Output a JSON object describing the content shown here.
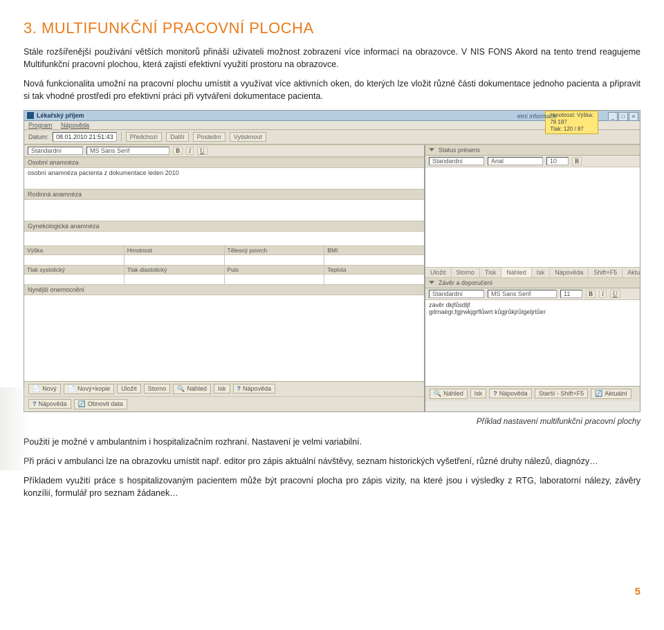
{
  "heading_prefix": "3.",
  "heading": "MULTIFUNKČNÍ PRACOVNÍ PLOCHA",
  "para1": "Stále rozšířenější používání větších monitorů přináší uživateli možnost zobrazení více informací na obrazovce. V NIS FONS Akord na tento trend reagujeme Multifunkční pracovní plochou, která zajistí efektivní využití prostoru na obrazovce.",
  "para2": "Nová funkcionalita umožní na pracovní plochu umístit a využívat více aktivních oken, do kterých lze vložit různé části dokumentace jednoho pacienta a připravit si tak vhodné prostředí pro efektivní práci při vytváření dokumentace pacienta.",
  "caption": "Příklad nastavení multifunkční pracovní plochy",
  "para3": "Použití je možné v ambulantním i hospitalizačním rozhraní. Nastavení je velmi variabilní.",
  "para4": "Při práci v ambulanci lze na obrazovku umístit např. editor pro zápis aktuální návštěvy, seznam historických vyšetření, různé druhy nálezů, diagnózy…",
  "para5": "Příkladem využití práce s hospitalizovaným pacientem může být pracovní plocha pro zápis vizity, na které jsou i výsledky z RTG, laboratorní nálezy, závěry konzílií, formulář pro seznam žádanek…",
  "page_number": "5",
  "app": {
    "title": "Lékařský příjem",
    "menu": {
      "program": "Program",
      "help": "Nápověda"
    },
    "note": {
      "l1": "Hmotnost: Výška:",
      "l2": "78       187",
      "l3": "Tlak: 120 / 87"
    },
    "winbtns": {
      "min": "_",
      "max": "□",
      "close": "×"
    },
    "toolbar": {
      "datum_lbl": "Datum:",
      "datum": "08.01.2010 21:51:43",
      "predchozi": "Předchozí",
      "dalsi": "Další",
      "posledni": "Poslední",
      "vytisknout": "Vytisknout"
    },
    "left": {
      "fmt_std": "Standardní",
      "fmt_font": "MS Sans Serif",
      "fmt_b": "B",
      "fmt_i": "I",
      "fmt_u": "U",
      "sec_osobni": "Osobní anamnéza",
      "osobni_text": "osobní anamnéza pacienta z dokumentace leden 2010",
      "sec_rodinna": "Rodinná anamnéza",
      "sec_gyn": "Gynekologická anamnéza",
      "f_vyska": "Výška",
      "f_hmotnost": "Hmotnost",
      "f_povrch": "Tělesný povrch",
      "f_bmi": "BMI",
      "f_sys": "Tlak systolický",
      "f_dia": "Tlak diastolický",
      "f_puls": "Puls",
      "f_teplota": "Teplota",
      "sec_nyn": "Nynější onemocnění",
      "foot": {
        "novy": "Nový",
        "novy_kopie": "Nový+kopie",
        "ulozit": "Uložit",
        "storno": "Storno",
        "nahled": "Náhled",
        "isk": "Isk",
        "napoveda": "Nápověda",
        "obnovit": "Obnovit data"
      }
    },
    "right": {
      "panel1": "Status présens",
      "fmt_std": "Standardní",
      "fmt_font": "Arial",
      "fmt_size": "10",
      "tabs": {
        "ulozit": "Uložit",
        "storno": "Storno",
        "tisk": "Tisk",
        "nahled": "Náhled",
        "isk": "Isk",
        "napoveda": "Nápověda",
        "shift": "Shift+F5",
        "aktualni": "Aktuální"
      },
      "panel2": "Závěr a doporučení",
      "fmt_font2": "MS Sans Serif",
      "fmt_size2": "11",
      "text2a": "závěr dkjfůsdljf",
      "text2b": "gdmaégr,fgjrwkjgrflůwrt kůgjrůkjrůtgeljrtůer",
      "foot": {
        "nahled": "Náhled",
        "isk": "Isk",
        "napoveda": "Nápověda",
        "starsi": "Starší - Shift+F5",
        "aktualni": "Aktuální"
      }
    },
    "extras": "etní informace"
  }
}
